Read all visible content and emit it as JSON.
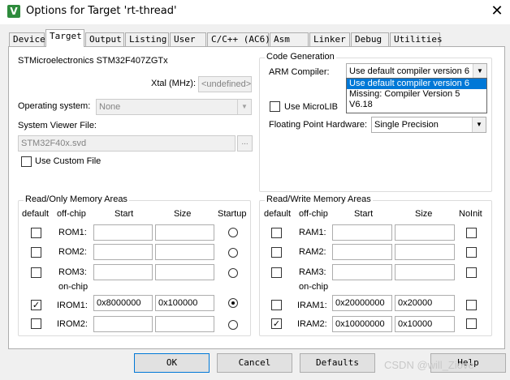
{
  "window": {
    "title": "Options for Target 'rt-thread'",
    "close_glyph": "✕",
    "app_icon_letter": "V"
  },
  "tabs": [
    {
      "label": "Device",
      "active": false
    },
    {
      "label": "Target",
      "active": true
    },
    {
      "label": "Output",
      "active": false
    },
    {
      "label": "Listing",
      "active": false
    },
    {
      "label": "User",
      "active": false
    },
    {
      "label": "C/C++ (AC6)",
      "active": false
    },
    {
      "label": "Asm",
      "active": false
    },
    {
      "label": "Linker",
      "active": false
    },
    {
      "label": "Debug",
      "active": false
    },
    {
      "label": "Utilities",
      "active": false
    }
  ],
  "target": {
    "device_name": "STMicroelectronics STM32F407ZGTx",
    "xtal_label": "Xtal (MHz):",
    "xtal_value": "<undefined>",
    "os_label": "Operating system:",
    "os_value": "None",
    "svd_label": "System Viewer File:",
    "svd_value": "STM32F40x.svd",
    "svd_browse": "...",
    "use_custom_file_label": "Use Custom File",
    "use_custom_file_checked": false
  },
  "code_generation": {
    "title": "Code Generation",
    "arm_compiler_label": "ARM Compiler:",
    "arm_compiler_value": "Use default compiler version 6",
    "compiler_options": [
      "Use default compiler version 6",
      "Missing: Compiler Version 5",
      "V6.18"
    ],
    "use_microlib_label": "Use MicroLIB",
    "use_microlib_checked": false,
    "fph_label": "Floating Point Hardware:",
    "fph_value": "Single Precision"
  },
  "rom_areas": {
    "title": "Read/Only Memory Areas",
    "headers": {
      "default": "default",
      "offchip": "off-chip",
      "start": "Start",
      "size": "Size",
      "startup": "Startup"
    },
    "onchip_label": "on-chip",
    "rows": [
      {
        "name": "ROM1:",
        "start": "",
        "size": "",
        "default": false,
        "startup": false
      },
      {
        "name": "ROM2:",
        "start": "",
        "size": "",
        "default": false,
        "startup": false
      },
      {
        "name": "ROM3:",
        "start": "",
        "size": "",
        "default": false,
        "startup": false
      },
      {
        "name": "IROM1:",
        "start": "0x8000000",
        "size": "0x100000",
        "default": true,
        "startup": true
      },
      {
        "name": "IROM2:",
        "start": "",
        "size": "",
        "default": false,
        "startup": false
      }
    ]
  },
  "ram_areas": {
    "title": "Read/Write Memory Areas",
    "headers": {
      "default": "default",
      "offchip": "off-chip",
      "start": "Start",
      "size": "Size",
      "noinit": "NoInit"
    },
    "onchip_label": "on-chip",
    "rows": [
      {
        "name": "RAM1:",
        "start": "",
        "size": "",
        "default": false,
        "noinit": false
      },
      {
        "name": "RAM2:",
        "start": "",
        "size": "",
        "default": false,
        "noinit": false
      },
      {
        "name": "RAM3:",
        "start": "",
        "size": "",
        "default": false,
        "noinit": false
      },
      {
        "name": "IRAM1:",
        "start": "0x20000000",
        "size": "0x20000",
        "default": false,
        "noinit": false
      },
      {
        "name": "IRAM2:",
        "start": "0x10000000",
        "size": "0x10000",
        "default": true,
        "noinit": false
      }
    ]
  },
  "buttons": {
    "ok": "OK",
    "cancel": "Cancel",
    "defaults": "Defaults",
    "help": "Help"
  },
  "watermark": "CSDN @will_Ziove",
  "icons": {
    "combo_arrow": "chevron-down-icon",
    "check_mark": "check-icon"
  },
  "colors": {
    "selection": "#0078d7",
    "dialog_bg": "#f0f0f0"
  }
}
